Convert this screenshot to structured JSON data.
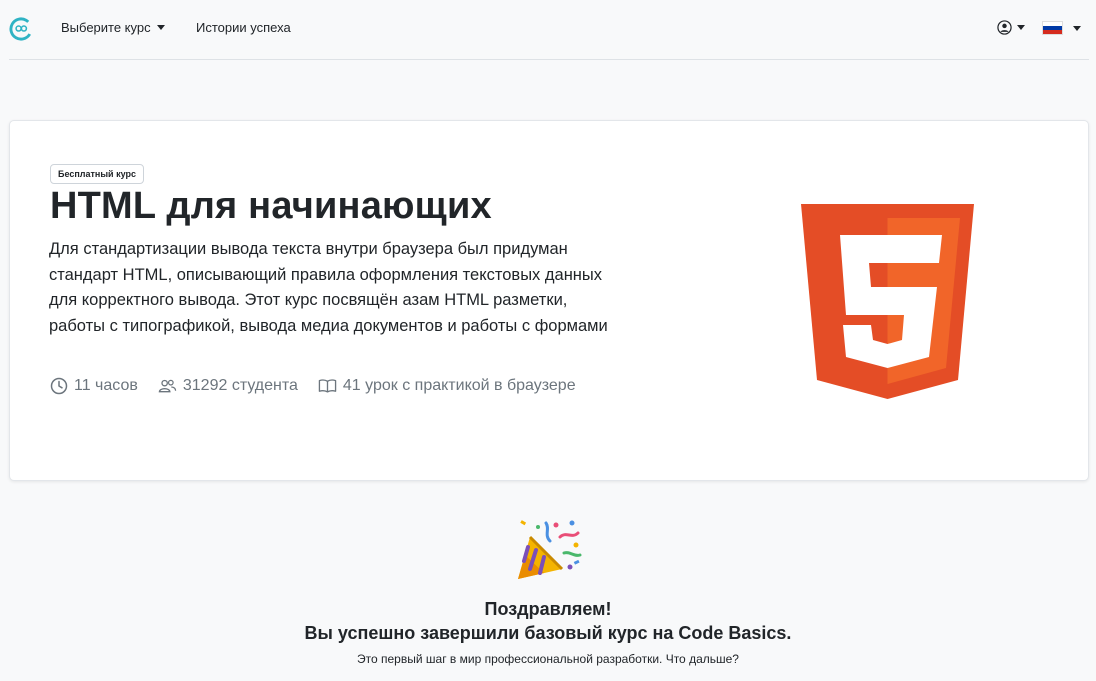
{
  "navbar": {
    "logo_icon": "code-basics-logo-icon",
    "choose_course": "Выберите курс",
    "success_stories": "Истории успеха",
    "user_icon": "user-circle-icon",
    "language_flag": "russia-flag-icon"
  },
  "course": {
    "badge": "Бесплатный курс",
    "title": "HTML для начинающих",
    "description": "Для стандартизации вывода текста внутри браузера был придуман стандарт HTML, описывающий правила оформления текстовых данных для корректного вывода. Этот курс посвящён азам HTML разметки, работы с типографикой, вывода медиа документов и работы с формами",
    "stats": {
      "duration": "11 часов",
      "students": "31292 студента",
      "lessons": "41 урок с практикой в браузере"
    },
    "logo_icon": "html5-logo-icon",
    "logo_text": "5"
  },
  "congrats": {
    "icon": "party-popper-icon",
    "line1": "Поздравляем!",
    "line2": "Вы успешно завершили базовый курс на Code Basics.",
    "subtitle": "Это первый шаг в мир профессиональной разработки. Что дальше?"
  },
  "colors": {
    "html5_orange": "#e44d26",
    "html5_light": "#f16529",
    "logo_teal": "#2fb3c4",
    "muted": "#6c757d"
  }
}
